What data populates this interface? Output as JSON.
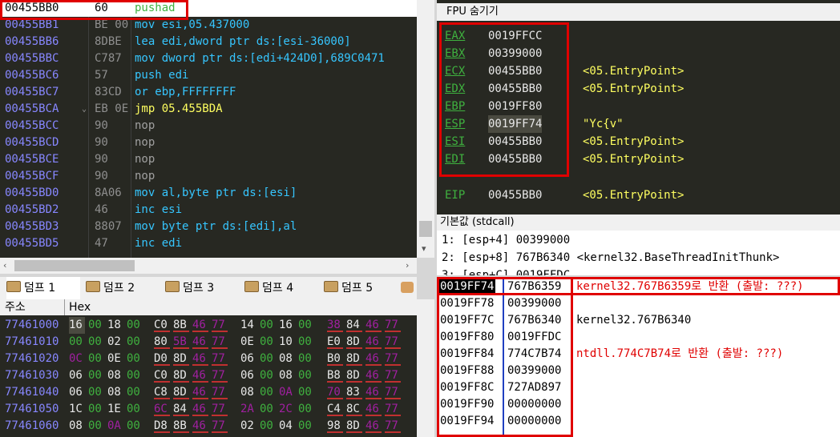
{
  "disasm": {
    "rows": [
      {
        "addr": "00455BB0",
        "bytes": "60",
        "instr": "pushad",
        "mn": "pushad"
      },
      {
        "addr": "00455BB1",
        "bytes": "BE 00",
        "instr": "mov esi,05.437000",
        "mn": "mov"
      },
      {
        "addr": "00455BB6",
        "bytes": "8DBE",
        "instr": "lea edi,dword ptr ds:[esi-36000]",
        "mn": "lea"
      },
      {
        "addr": "00455BBC",
        "bytes": "C787",
        "instr": "mov dword ptr ds:[edi+424D0],689C0471",
        "mn": "mov"
      },
      {
        "addr": "00455BC6",
        "bytes": "57",
        "instr": "push edi",
        "mn": "push"
      },
      {
        "addr": "00455BC7",
        "bytes": "83CD",
        "instr": "or ebp,FFFFFFFF",
        "mn": "or"
      },
      {
        "addr": "00455BCA",
        "bytes": "EB 0E",
        "instr": "jmp 05.455BDA",
        "mn": "jmp"
      },
      {
        "addr": "00455BCC",
        "bytes": "90",
        "instr": "nop",
        "mn": "nop"
      },
      {
        "addr": "00455BCD",
        "bytes": "90",
        "instr": "nop",
        "mn": "nop"
      },
      {
        "addr": "00455BCE",
        "bytes": "90",
        "instr": "nop",
        "mn": "nop"
      },
      {
        "addr": "00455BCF",
        "bytes": "90",
        "instr": "nop",
        "mn": "nop"
      },
      {
        "addr": "00455BD0",
        "bytes": "8A06",
        "instr": "mov al,byte ptr ds:[esi]",
        "mn": "mov"
      },
      {
        "addr": "00455BD2",
        "bytes": "46",
        "instr": "inc esi",
        "mn": "inc"
      },
      {
        "addr": "00455BD3",
        "bytes": "8807",
        "instr": "mov byte ptr ds:[edi],al",
        "mn": "mov"
      },
      {
        "addr": "00455BD5",
        "bytes": "47",
        "instr": "inc edi",
        "mn": "inc"
      }
    ]
  },
  "registers": {
    "header": "FPU 숨기기",
    "rows": [
      {
        "name": "EAX",
        "value": "0019FFCC",
        "comment": ""
      },
      {
        "name": "EBX",
        "value": "00399000",
        "comment": ""
      },
      {
        "name": "ECX",
        "value": "00455BB0",
        "comment": "<05.EntryPoint>"
      },
      {
        "name": "EDX",
        "value": "00455BB0",
        "comment": "<05.EntryPoint>"
      },
      {
        "name": "EBP",
        "value": "0019FF80",
        "comment": ""
      },
      {
        "name": "ESP",
        "value": "0019FF74",
        "comment": "\"Yc{v\""
      },
      {
        "name": "ESI",
        "value": "00455BB0",
        "comment": "<05.EntryPoint>"
      },
      {
        "name": "EDI",
        "value": "00455BB0",
        "comment": "<05.EntryPoint>"
      }
    ],
    "eip": {
      "name": "EIP",
      "value": "00455BB0",
      "comment": "<05.EntryPoint>"
    }
  },
  "args": {
    "header": "기본값 (stdcall)",
    "rows": [
      "1: [esp+4] 00399000",
      "2: [esp+8] 767B6340 <kernel32.BaseThreadInitThunk>",
      "3: [esp+C] 0019FFDC"
    ]
  },
  "tabs": [
    "덤프 1",
    "덤프 2",
    "덤프 3",
    "덤프 4",
    "덤프 5"
  ],
  "dump": {
    "col_addr": "주소",
    "col_hex": "Hex",
    "rows": [
      {
        "addr": "77461000",
        "bytes": [
          [
            "16",
            "w"
          ],
          [
            "00",
            "g"
          ],
          [
            "18",
            "w"
          ],
          [
            "00",
            "g"
          ],
          [
            "C0",
            "w"
          ],
          [
            "8B",
            "w"
          ],
          [
            "46",
            "p"
          ],
          [
            "77",
            "p"
          ],
          [
            "14",
            "w"
          ],
          [
            "00",
            "g"
          ],
          [
            "16",
            "w"
          ],
          [
            "00",
            "g"
          ],
          [
            "38",
            "p"
          ],
          [
            "84",
            "w"
          ],
          [
            "46",
            "p"
          ],
          [
            "77",
            "p"
          ]
        ]
      },
      {
        "addr": "77461010",
        "bytes": [
          [
            "00",
            "g"
          ],
          [
            "00",
            "g"
          ],
          [
            "02",
            "w"
          ],
          [
            "00",
            "g"
          ],
          [
            "80",
            "w"
          ],
          [
            "5B",
            "p"
          ],
          [
            "46",
            "p"
          ],
          [
            "77",
            "p"
          ],
          [
            "0E",
            "w"
          ],
          [
            "00",
            "g"
          ],
          [
            "10",
            "w"
          ],
          [
            "00",
            "g"
          ],
          [
            "E0",
            "w"
          ],
          [
            "8D",
            "w"
          ],
          [
            "46",
            "p"
          ],
          [
            "77",
            "p"
          ]
        ]
      },
      {
        "addr": "77461020",
        "bytes": [
          [
            "0C",
            "p"
          ],
          [
            "00",
            "g"
          ],
          [
            "0E",
            "w"
          ],
          [
            "00",
            "g"
          ],
          [
            "D0",
            "w"
          ],
          [
            "8D",
            "w"
          ],
          [
            "46",
            "p"
          ],
          [
            "77",
            "p"
          ],
          [
            "06",
            "w"
          ],
          [
            "00",
            "g"
          ],
          [
            "08",
            "w"
          ],
          [
            "00",
            "g"
          ],
          [
            "B0",
            "w"
          ],
          [
            "8D",
            "w"
          ],
          [
            "46",
            "p"
          ],
          [
            "77",
            "p"
          ]
        ]
      },
      {
        "addr": "77461030",
        "bytes": [
          [
            "06",
            "w"
          ],
          [
            "00",
            "g"
          ],
          [
            "08",
            "w"
          ],
          [
            "00",
            "g"
          ],
          [
            "C0",
            "w"
          ],
          [
            "8D",
            "w"
          ],
          [
            "46",
            "p"
          ],
          [
            "77",
            "p"
          ],
          [
            "06",
            "w"
          ],
          [
            "00",
            "g"
          ],
          [
            "08",
            "w"
          ],
          [
            "00",
            "g"
          ],
          [
            "B8",
            "w"
          ],
          [
            "8D",
            "w"
          ],
          [
            "46",
            "p"
          ],
          [
            "77",
            "p"
          ]
        ]
      },
      {
        "addr": "77461040",
        "bytes": [
          [
            "06",
            "w"
          ],
          [
            "00",
            "g"
          ],
          [
            "08",
            "w"
          ],
          [
            "00",
            "g"
          ],
          [
            "C8",
            "w"
          ],
          [
            "8D",
            "w"
          ],
          [
            "46",
            "p"
          ],
          [
            "77",
            "p"
          ],
          [
            "08",
            "w"
          ],
          [
            "00",
            "g"
          ],
          [
            "0A",
            "p"
          ],
          [
            "00",
            "g"
          ],
          [
            "70",
            "p"
          ],
          [
            "83",
            "w"
          ],
          [
            "46",
            "p"
          ],
          [
            "77",
            "p"
          ]
        ]
      },
      {
        "addr": "77461050",
        "bytes": [
          [
            "1C",
            "w"
          ],
          [
            "00",
            "g"
          ],
          [
            "1E",
            "w"
          ],
          [
            "00",
            "g"
          ],
          [
            "6C",
            "p"
          ],
          [
            "84",
            "w"
          ],
          [
            "46",
            "p"
          ],
          [
            "77",
            "p"
          ],
          [
            "2A",
            "p"
          ],
          [
            "00",
            "g"
          ],
          [
            "2C",
            "p"
          ],
          [
            "00",
            "g"
          ],
          [
            "C4",
            "w"
          ],
          [
            "8C",
            "w"
          ],
          [
            "46",
            "p"
          ],
          [
            "77",
            "p"
          ]
        ]
      },
      {
        "addr": "77461060",
        "bytes": [
          [
            "08",
            "w"
          ],
          [
            "00",
            "g"
          ],
          [
            "0A",
            "p"
          ],
          [
            "00",
            "g"
          ],
          [
            "D8",
            "w"
          ],
          [
            "8B",
            "w"
          ],
          [
            "46",
            "p"
          ],
          [
            "77",
            "p"
          ],
          [
            "02",
            "w"
          ],
          [
            "00",
            "g"
          ],
          [
            "04",
            "w"
          ],
          [
            "00",
            "g"
          ],
          [
            "98",
            "w"
          ],
          [
            "8D",
            "w"
          ],
          [
            "46",
            "p"
          ],
          [
            "77",
            "p"
          ]
        ]
      }
    ]
  },
  "stack": {
    "rows": [
      {
        "addr": "0019FF74",
        "val": "767B6359",
        "cmt": "kernel32.767B6359로 반환 (출발: ???)",
        "red": true
      },
      {
        "addr": "0019FF78",
        "val": "00399000",
        "cmt": "",
        "red": false
      },
      {
        "addr": "0019FF7C",
        "val": "767B6340",
        "cmt": "kernel32.767B6340",
        "red": false
      },
      {
        "addr": "0019FF80",
        "val": "0019FFDC",
        "cmt": "",
        "red": false
      },
      {
        "addr": "0019FF84",
        "val": "774C7B74",
        "cmt": "ntdll.774C7B74로 반환 (출발: ???)",
        "red": true
      },
      {
        "addr": "0019FF88",
        "val": "00399000",
        "cmt": "",
        "red": false
      },
      {
        "addr": "0019FF8C",
        "val": "727AD897",
        "cmt": "",
        "red": false
      },
      {
        "addr": "0019FF90",
        "val": "00000000",
        "cmt": "",
        "red": false
      },
      {
        "addr": "0019FF94",
        "val": "00000000",
        "cmt": "",
        "red": false
      }
    ]
  }
}
